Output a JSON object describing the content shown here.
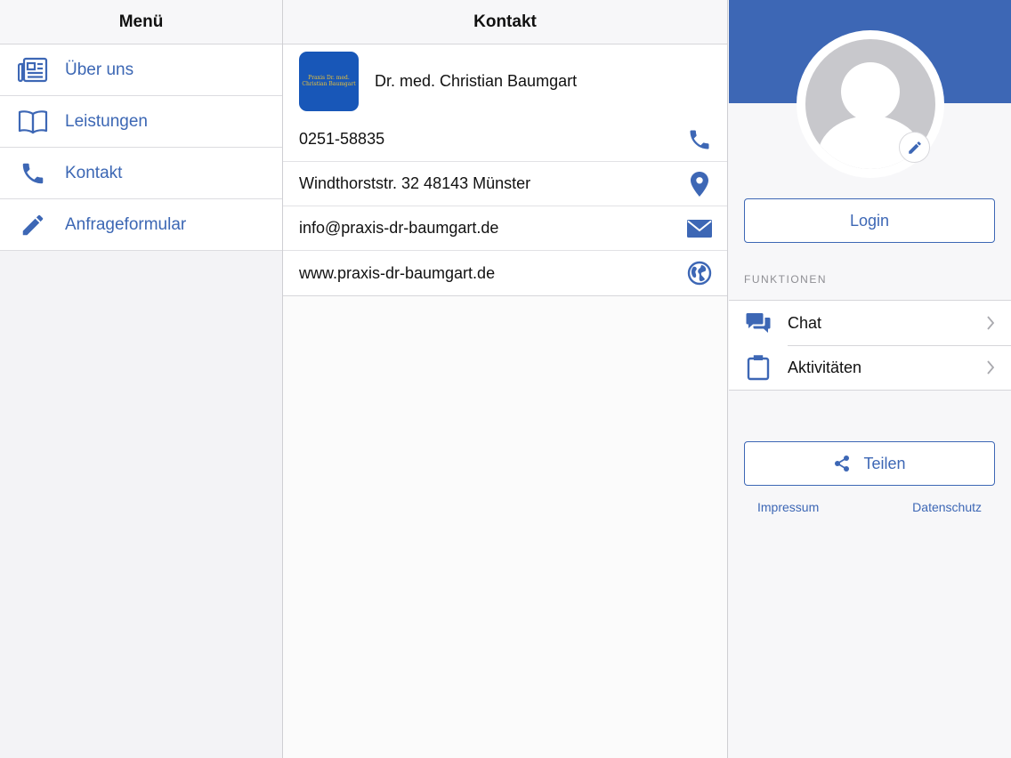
{
  "menu": {
    "title": "Menü",
    "items": [
      {
        "label": "Über uns",
        "icon": "newspaper-icon"
      },
      {
        "label": "Leistungen",
        "icon": "book-icon"
      },
      {
        "label": "Kontakt",
        "icon": "phone-icon"
      },
      {
        "label": "Anfrageformular",
        "icon": "pencil-icon"
      }
    ]
  },
  "contact": {
    "title": "Kontakt",
    "logo_text": [
      "Praxis Dr. med.",
      "Christian Baumgart"
    ],
    "name": "Dr. med. Christian Baumgart",
    "rows": [
      {
        "text": "0251-58835",
        "icon": "phone-icon"
      },
      {
        "text": "Windthorststr. 32 48143 Münster",
        "icon": "map-pin-icon"
      },
      {
        "text": "info@praxis-dr-baumgart.de",
        "icon": "envelope-icon"
      },
      {
        "text": "www.praxis-dr-baumgart.de",
        "icon": "globe-icon"
      }
    ]
  },
  "profile": {
    "login_label": "Login",
    "functions_label": "FUNKTIONEN",
    "functions": [
      {
        "label": "Chat",
        "icon": "chat-bubbles-icon"
      },
      {
        "label": "Aktivitäten",
        "icon": "clipboard-icon"
      }
    ],
    "share_label": "Teilen",
    "impressum_label": "Impressum",
    "datenschutz_label": "Datenschutz"
  },
  "colors": {
    "accent": "#3d67b5",
    "logo_bg": "#1857b8",
    "logo_text": "#e8c13a"
  }
}
